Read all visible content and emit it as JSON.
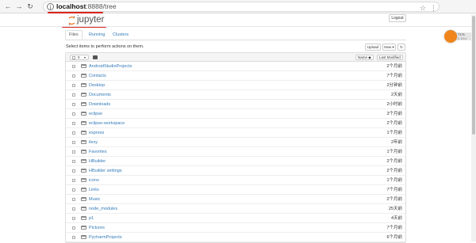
{
  "browser": {
    "url_host": "localhost",
    "url_port": ":8888",
    "url_path": "/tree",
    "accent_color": "#d7261f"
  },
  "app": {
    "logo_text": "jupyter",
    "logout_label": "Logout"
  },
  "tabs": [
    {
      "label": "Files",
      "active": true
    },
    {
      "label": "Running",
      "active": false
    },
    {
      "label": "Clusters",
      "active": false
    }
  ],
  "toolbar": {
    "hint": "Select items to perform actions on them.",
    "upload_label": "Upload",
    "new_label": "New ▾",
    "refresh_icon": "refresh-icon"
  },
  "list": {
    "selected_count": "0",
    "sort_name_label": "Name ◆",
    "sort_modified_label": "Last Modified",
    "items": [
      {
        "name": "AndroidStudioProjects",
        "modified": "2个月前"
      },
      {
        "name": "Contacts",
        "modified": "7个月前"
      },
      {
        "name": "Desktop",
        "modified": "2分钟前"
      },
      {
        "name": "Documents",
        "modified": "2天前"
      },
      {
        "name": "Downloads",
        "modified": "2小时前"
      },
      {
        "name": "eclipse",
        "modified": "3个月前"
      },
      {
        "name": "eclipse-workspace",
        "modified": "2个月前"
      },
      {
        "name": "express",
        "modified": "1个月前"
      },
      {
        "name": "ilexy",
        "modified": "2年前"
      },
      {
        "name": "Favorites",
        "modified": "1个月前"
      },
      {
        "name": "HBuilder",
        "modified": "2个月前"
      },
      {
        "name": "HBuilder settings",
        "modified": "2个月前"
      },
      {
        "name": "icons",
        "modified": "1个月前"
      },
      {
        "name": "Links",
        "modified": "7个月前"
      },
      {
        "name": "Music",
        "modified": "2个月前"
      },
      {
        "name": "node_modules",
        "modified": "25天前"
      },
      {
        "name": "p1",
        "modified": "4天前"
      },
      {
        "name": "Pictures",
        "modified": "7个月前"
      },
      {
        "name": "PycharmProjects",
        "modified": "6个月前"
      }
    ]
  },
  "widget": {
    "percent": "71%",
    "value": "0.1K/s"
  }
}
